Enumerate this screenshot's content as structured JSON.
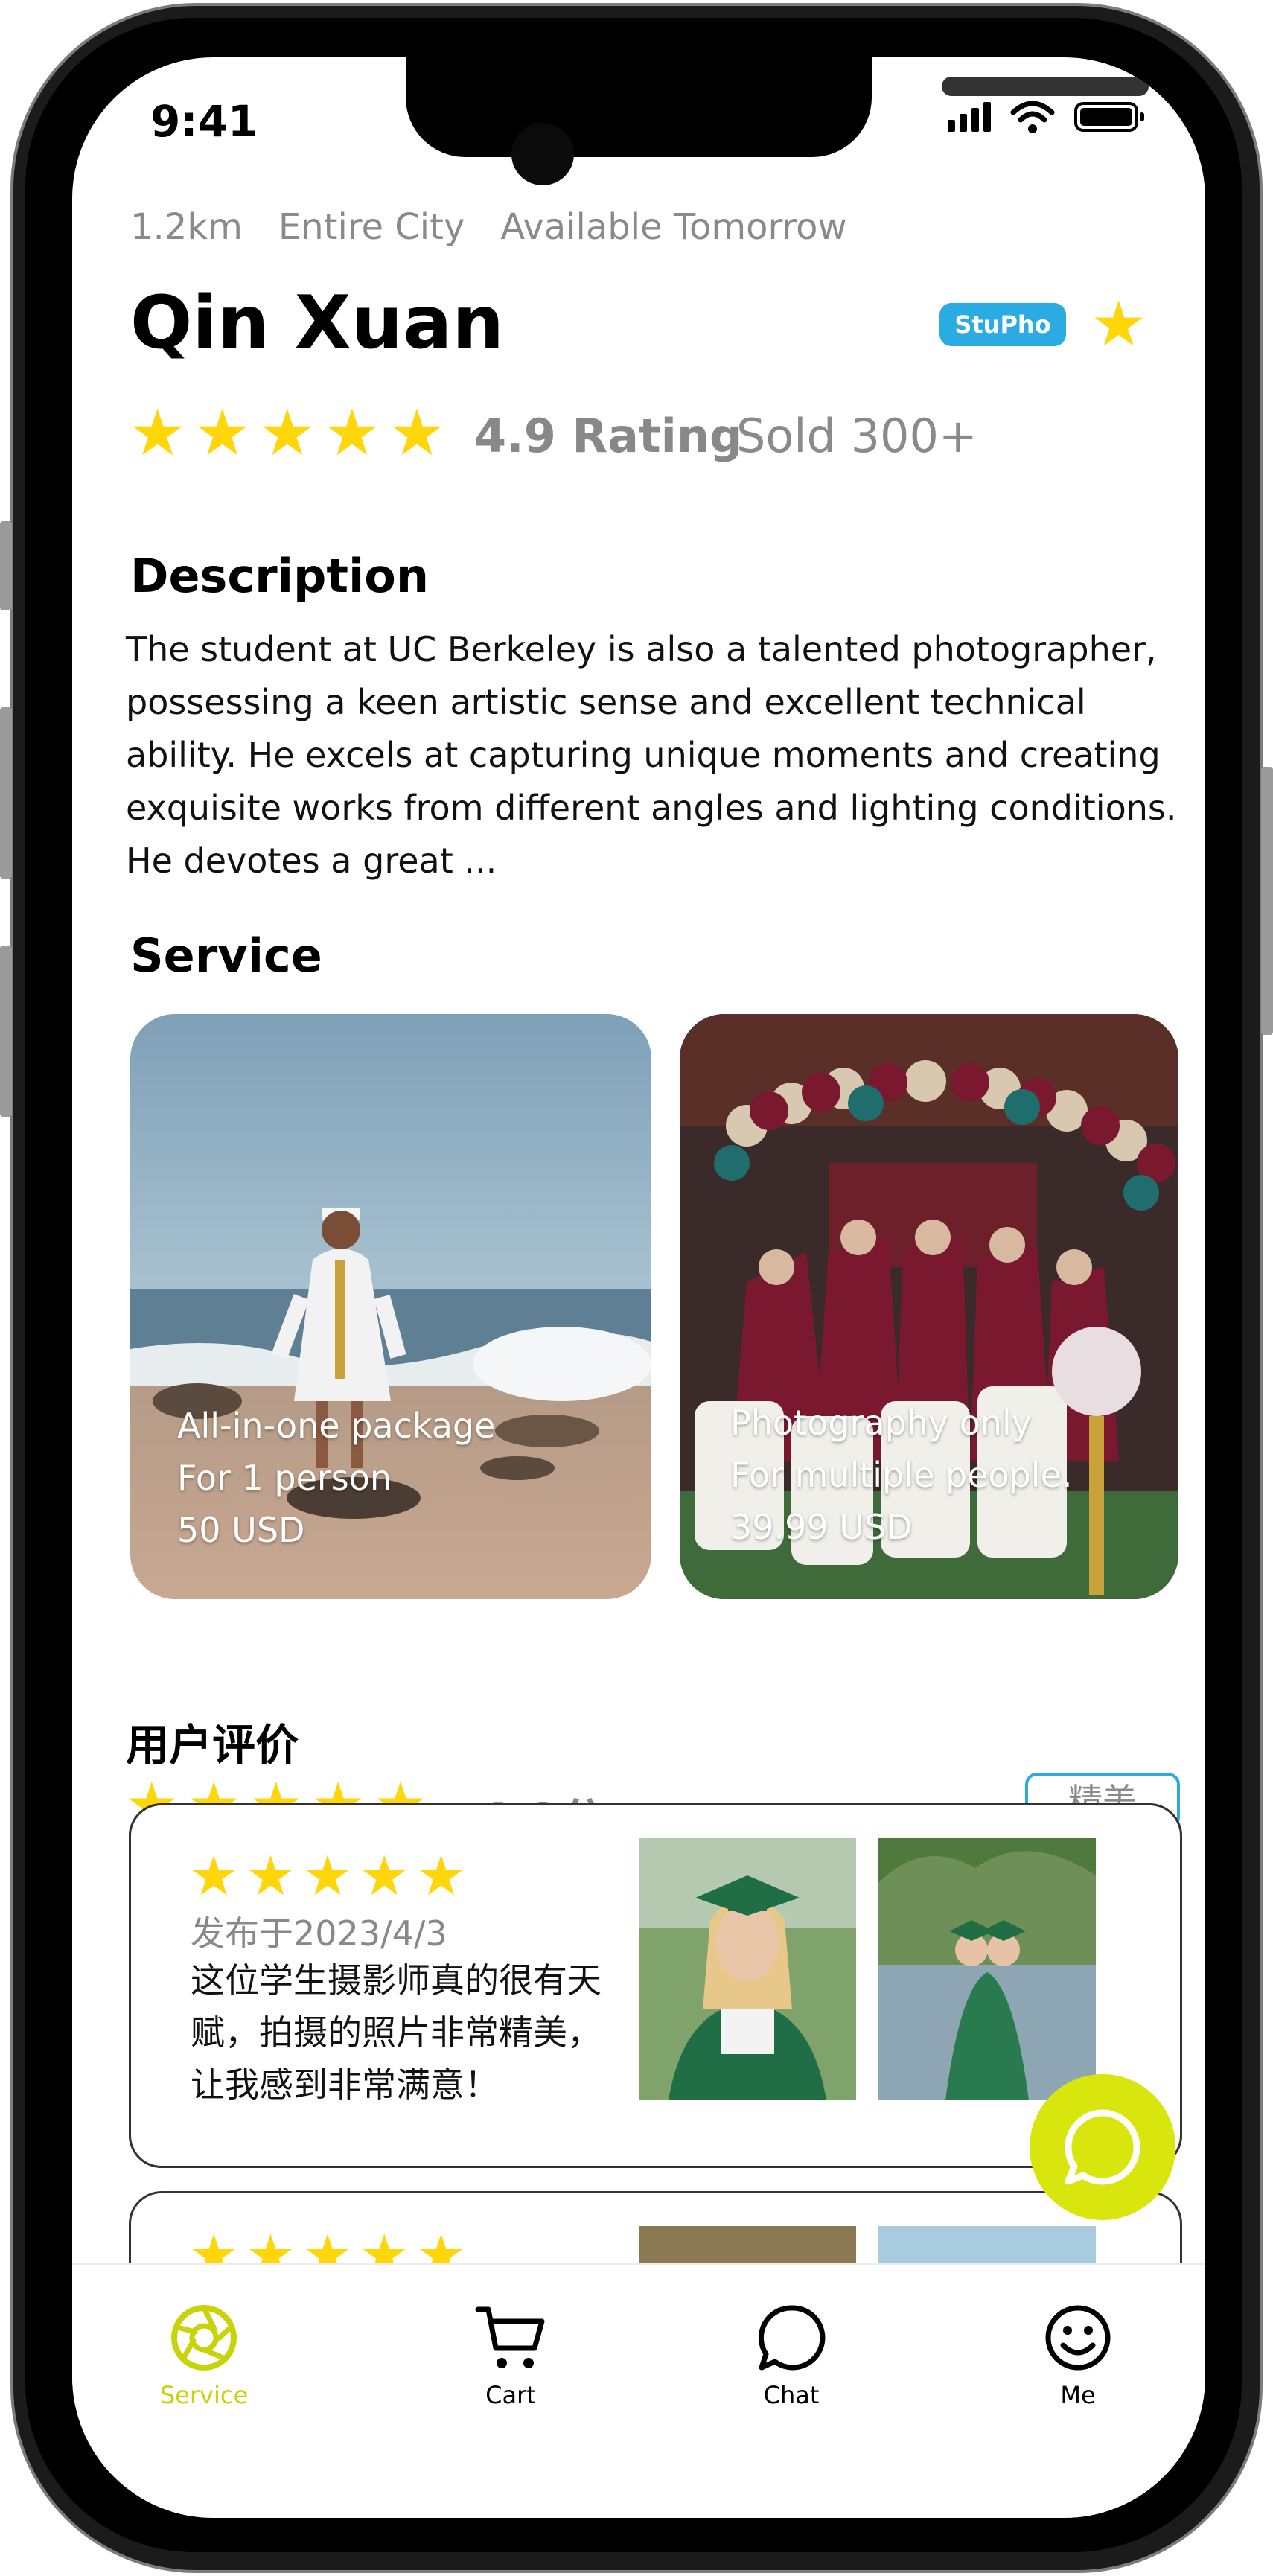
{
  "status_bar": {
    "time": "9:41"
  },
  "meta": {
    "distance": "1.2km",
    "area": "Entire City",
    "availability": "Available Tomorrow"
  },
  "profile": {
    "name": "Qin Xuan",
    "tag": "StuPho",
    "rating_stars": 5,
    "rating_text": "4.9 Rating",
    "sold_text": "Sold 300+"
  },
  "description": {
    "title": "Description",
    "text": "The student at UC Berkeley is also a talented photographer, possessing a keen artistic sense and excellent technical ability. He excels at capturing unique moments and creating exquisite works from different angles and lighting conditions. He devotes a great ..."
  },
  "service": {
    "title": "Service",
    "cards": [
      {
        "line1": "All-in-one package",
        "line2": "For 1 person",
        "line3": "50 USD"
      },
      {
        "line1": "Photography only",
        "line2": "For multiple people.",
        "line3": "39.99 USD"
      }
    ]
  },
  "reviews": {
    "title": "用户评价",
    "score": "4.9分",
    "stars": 5,
    "badge": "精美",
    "items": [
      {
        "stars": 5,
        "date": "发布于2023/4/3",
        "text": "这位学生摄影师真的很有天赋，拍摄的照片非常精美，让我感到非常满意！"
      },
      {
        "stars": 5
      }
    ]
  },
  "tabbar": {
    "items": [
      {
        "label": "Service",
        "icon": "aperture-icon",
        "active": true
      },
      {
        "label": "Cart",
        "icon": "cart-icon",
        "active": false
      },
      {
        "label": "Chat",
        "icon": "chat-bubble-icon",
        "active": false
      },
      {
        "label": "Me",
        "icon": "smiley-icon",
        "active": false
      }
    ]
  },
  "colors": {
    "accent": "#d8e60e",
    "star": "#ffd60a",
    "tag": "#2aace2",
    "tab_active": "#c8d40a"
  }
}
